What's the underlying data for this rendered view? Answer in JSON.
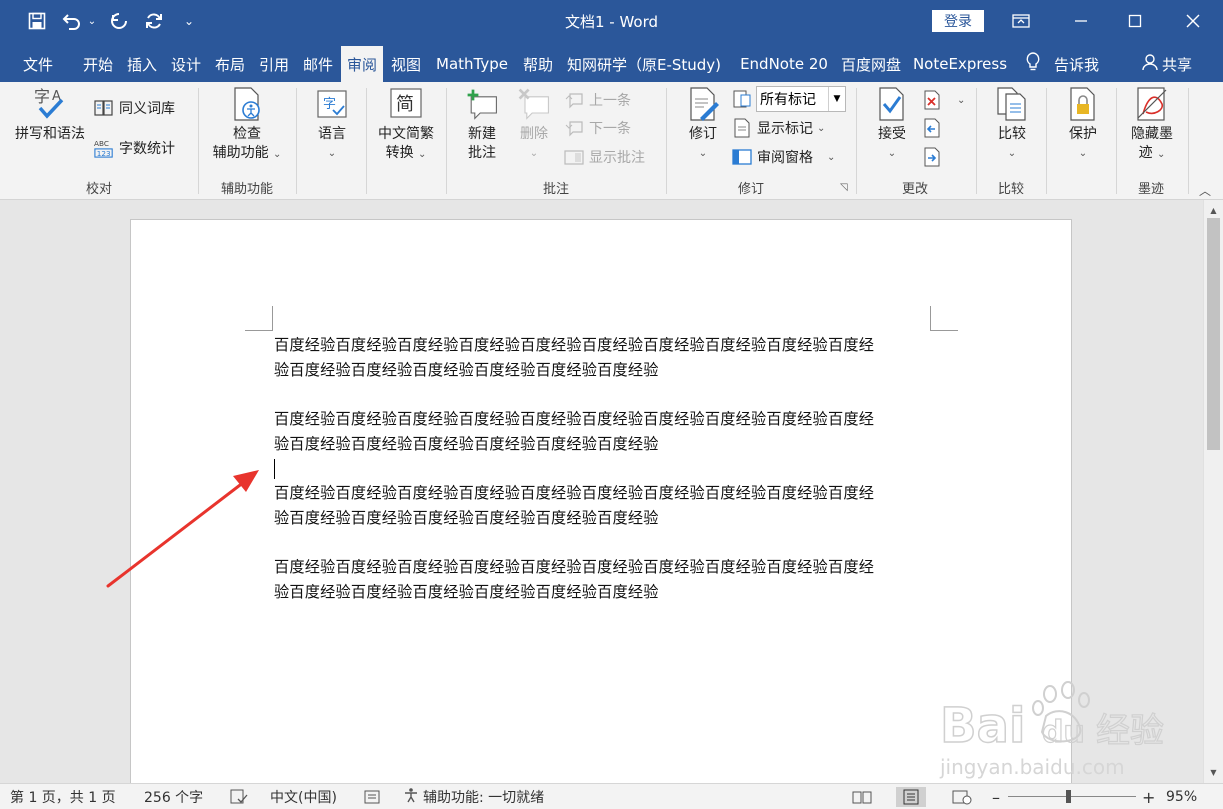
{
  "titlebar": {
    "title": "文档1  -  Word",
    "login": "登录",
    "qat": [
      "save-icon",
      "undo-icon",
      "redo-icon",
      "repeat-icon",
      "customize-icon"
    ]
  },
  "tabs": [
    {
      "label": "文件"
    },
    {
      "label": "开始"
    },
    {
      "label": "插入"
    },
    {
      "label": "设计"
    },
    {
      "label": "布局"
    },
    {
      "label": "引用"
    },
    {
      "label": "邮件"
    },
    {
      "label": "审阅",
      "active": true
    },
    {
      "label": "视图"
    },
    {
      "label": "MathType"
    },
    {
      "label": "帮助"
    },
    {
      "label": "知网研学（原E-Study)"
    },
    {
      "label": "EndNote 20"
    },
    {
      "label": "百度网盘"
    },
    {
      "label": "NoteExpress"
    }
  ],
  "tell_me": "告诉我",
  "share": "共享",
  "ribbon": {
    "proofing": {
      "label": "校对",
      "spelling": "拼写和语法",
      "thesaurus": "同义词库",
      "wordcount": "字数统计"
    },
    "accessibility": {
      "label": "辅助功能",
      "check_line1": "检查",
      "check_line2": "辅助功能"
    },
    "language": {
      "label": "语言"
    },
    "chinese": {
      "line1": "中文简繁",
      "line2": "转换"
    },
    "comments": {
      "label": "批注",
      "new_line1": "新建",
      "new_line2": "批注",
      "delete": "删除",
      "prev": "上一条",
      "next": "下一条",
      "show": "显示批注"
    },
    "tracking": {
      "label": "修订",
      "track": "修订",
      "markup_select": "所有标记",
      "show_markup": "显示标记",
      "review_pane": "审阅窗格"
    },
    "changes": {
      "label": "更改",
      "accept": "接受"
    },
    "compare": {
      "label": "比较",
      "compare": "比较"
    },
    "protect": {
      "protect": "保护"
    },
    "ink": {
      "label": "墨迹",
      "hide_line1": "隐藏墨",
      "hide_line2": "迹"
    }
  },
  "document": {
    "paragraphs": [
      {
        "line1": "百度经验百度经验百度经验百度经验百度经验百度经验百度经验百度经验百度经验百度经",
        "line2": "验百度经验百度经验百度经验百度经验百度经验百度经验"
      },
      {
        "line1": "百度经验百度经验百度经验百度经验百度经验百度经验百度经验百度经验百度经验百度经",
        "line2": "验百度经验百度经验百度经验百度经验百度经验百度经验"
      },
      {
        "line1": "百度经验百度经验百度经验百度经验百度经验百度经验百度经验百度经验百度经验百度经",
        "line2": "验百度经验百度经验百度经验百度经验百度经验百度经验"
      },
      {
        "line1": "百度经验百度经验百度经验百度经验百度经验百度经验百度经验百度经验百度经验百度经",
        "line2": "验百度经验百度经验百度经验百度经验百度经验百度经验"
      }
    ],
    "annotation_color": "#e8342d"
  },
  "watermark": {
    "brand": "Bai",
    "brand_suffix": "经验",
    "url": "jingyan.baidu.com"
  },
  "statusbar": {
    "page": "第 1 页，共 1 页",
    "words": "256 个字",
    "language": "中文(中国)",
    "accessibility": "辅助功能: 一切就绪",
    "zoom": "95%"
  },
  "colors": {
    "accent": "#2b579a",
    "ribbon_bg": "#f3f3f3"
  }
}
